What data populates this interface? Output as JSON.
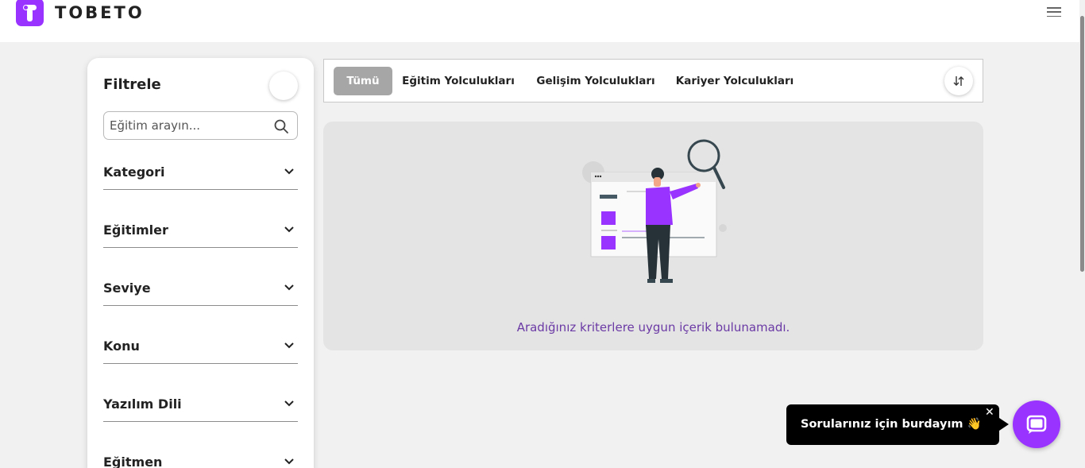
{
  "header": {
    "logo_text": "TOBETO",
    "brand_color": "#9933ff",
    "menu_icon": "hamburger-icon"
  },
  "filter": {
    "title": "Filtrele",
    "search_placeholder": "Eğitim arayın...",
    "search_icon": "search-icon",
    "sections": [
      {
        "label": "Kategori"
      },
      {
        "label": "Eğitimler"
      },
      {
        "label": "Seviye"
      },
      {
        "label": "Konu"
      },
      {
        "label": "Yazılım Dili"
      },
      {
        "label": "Eğitmen"
      }
    ]
  },
  "tabs": {
    "items": [
      {
        "label": "Tümü",
        "active": true
      },
      {
        "label": "Eğitim Yolculukları",
        "active": false
      },
      {
        "label": "Gelişim Yolculukları",
        "active": false
      },
      {
        "label": "Kariyer Yolculukları",
        "active": false
      }
    ],
    "sort_icon": "sort-arrows-icon"
  },
  "results": {
    "empty_message": "Aradığınız kriterlere uygun içerik bulunamadı.",
    "message_color": "#6b3aa5"
  },
  "chat": {
    "message": "Sorularınız için burdayım 👋",
    "close_label": "✕",
    "icon": "chat-icon"
  }
}
